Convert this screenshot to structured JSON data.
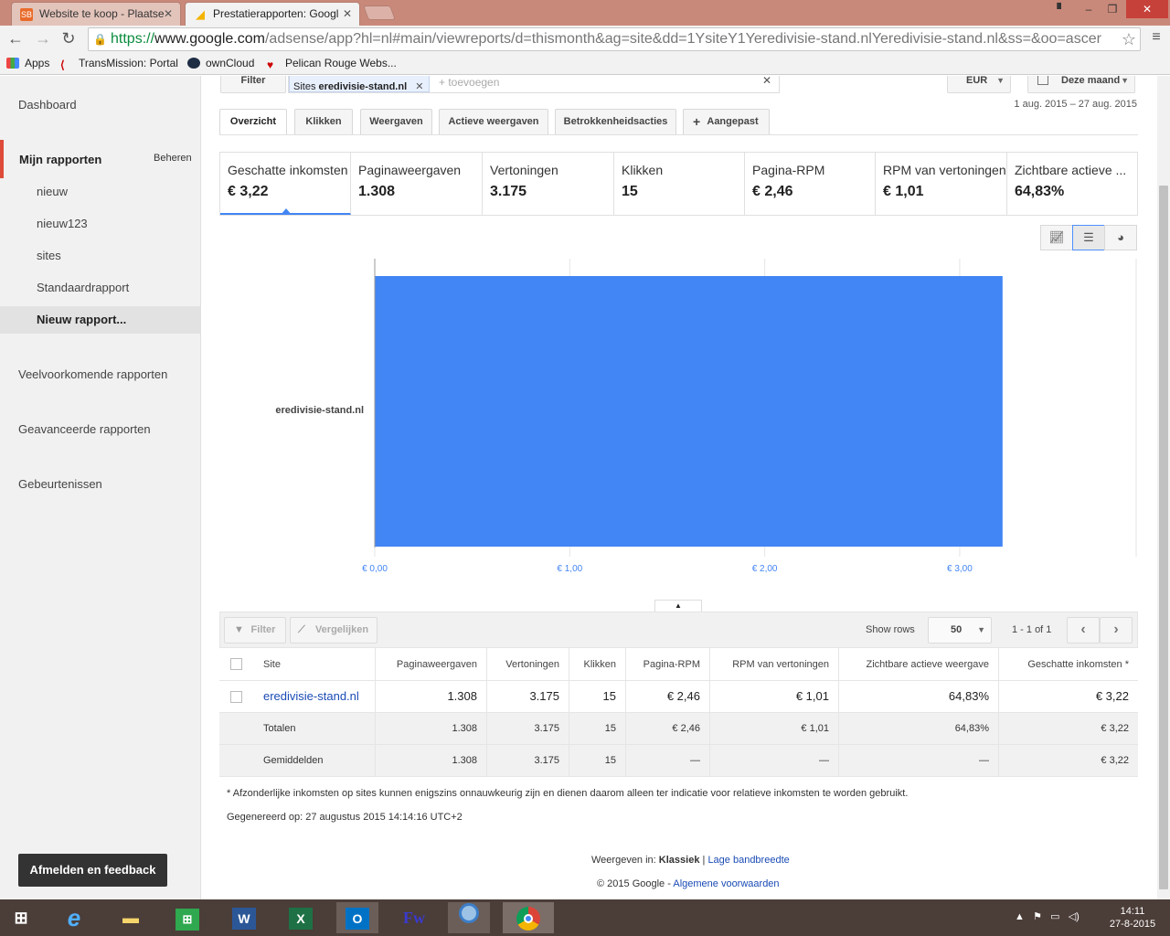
{
  "browser": {
    "tabs": [
      {
        "title": "Website te koop - Plaatse",
        "icon": "site-favicon",
        "color": "#e96b2b"
      },
      {
        "title": "Prestatierapporten: Googl",
        "icon": "adsense-favicon",
        "color": "#f4b400"
      }
    ],
    "url": {
      "scheme": "https://",
      "host": "www.google.com",
      "path": "/adsense/app?hl=nl#main/viewreports/d=thismonth&ag=site&dd=1YsiteY1Yeredivisie-stand.nlYeredivisie-stand.nl&ss=&oo=ascer"
    },
    "bookmarks": [
      "Apps",
      "TransMission: Portal",
      "ownCloud",
      "Pelican Rouge Webs..."
    ]
  },
  "sidebar": {
    "dashboard": "Dashboard",
    "my_reports": "Mijn rapporten",
    "manage": "Beheren",
    "reports": [
      "nieuw",
      "nieuw123",
      "sites",
      "Standaardrapport",
      "Nieuw rapport..."
    ],
    "common_reports": "Veelvoorkomende rapporten",
    "advanced_reports": "Geavanceerde rapporten",
    "events": "Gebeurtenissen",
    "feedback": "Afmelden en feedback"
  },
  "filterbar": {
    "filter_label": "Filter",
    "chip_prefix": "Sites",
    "chip_value": "eredivisie-stand.nl",
    "add_placeholder": "+ toevoegen",
    "currency": "EUR",
    "period": "Deze maand",
    "date_range": "1 aug. 2015 – 27 aug. 2015"
  },
  "view_tabs": [
    "Overzicht",
    "Klikken",
    "Weergaven",
    "Actieve weergaven",
    "Betrokkenheidsacties",
    "Aangepast"
  ],
  "metrics": [
    {
      "label": "Geschatte inkomsten",
      "value": "€ 3,22"
    },
    {
      "label": "Paginaweergaven",
      "value": "1.308"
    },
    {
      "label": "Vertoningen",
      "value": "3.175"
    },
    {
      "label": "Klikken",
      "value": "15"
    },
    {
      "label": "Pagina-RPM",
      "value": "€ 2,46"
    },
    {
      "label": "RPM van vertoningen",
      "value": "€ 1,01"
    },
    {
      "label": "Zichtbare actieve ...",
      "value": "64,83%"
    }
  ],
  "chart_icons": [
    "line-chart-icon",
    "bar-chart-icon",
    "pie-chart-icon"
  ],
  "chart_data": {
    "type": "bar",
    "orientation": "horizontal",
    "categories": [
      "eredivisie-stand.nl"
    ],
    "values": [
      3.22
    ],
    "xlim": [
      0,
      3.0
    ],
    "x_ticks": [
      "€ 0,00",
      "€ 1,00",
      "€ 2,00",
      "€ 3,00"
    ],
    "x_tick_values": [
      0,
      1,
      2,
      3
    ],
    "bar_color": "#4285f4",
    "grid": true
  },
  "table_toolbar": {
    "filter": "Filter",
    "compare": "Vergelijken",
    "show_rows_label": "Show rows",
    "show_rows_value": "50",
    "pager": "1 - 1 of 1"
  },
  "table": {
    "headers": [
      "Site",
      "Paginaweergaven",
      "Vertoningen",
      "Klikken",
      "Pagina-RPM",
      "RPM van vertoningen",
      "Zichtbare actieve weergave",
      "Geschatte inkomsten *"
    ],
    "rows": [
      [
        "eredivisie-stand.nl",
        "1.308",
        "3.175",
        "15",
        "€ 2,46",
        "€ 1,01",
        "64,83%",
        "€ 3,22"
      ]
    ],
    "totals": [
      "Totalen",
      "1.308",
      "3.175",
      "15",
      "€ 2,46",
      "€ 1,01",
      "64,83%",
      "€ 3,22"
    ],
    "averages": [
      "Gemiddelden",
      "1.308",
      "3.175",
      "15",
      "—",
      "—",
      "—",
      "€ 3,22"
    ]
  },
  "footer": {
    "footnote": "* Afzonderlijke inkomsten op sites kunnen enigszins onnauwkeurig zijn en dienen daarom alleen ter indicatie voor relatieve inkomsten te worden gebruikt.",
    "generated": "Gegenereerd op: 27 augustus 2015 14:14:16 UTC+2",
    "view_in_label": "Weergeven in:",
    "view_classic": "Klassiek",
    "view_separator": "|",
    "view_low_bandwidth": "Lage bandbreedte",
    "copyright": "© 2015 Google",
    "copyright_sep": "-",
    "terms": "Algemene voorwaarden"
  },
  "taskbar": {
    "apps": [
      "start-icon",
      "ie-icon",
      "explorer-icon",
      "store-icon",
      "word-icon",
      "excel-icon",
      "outlook-icon",
      "frontpage-icon",
      "app-icon",
      "chrome-icon"
    ],
    "time": "14:11",
    "date": "27-8-2015"
  }
}
